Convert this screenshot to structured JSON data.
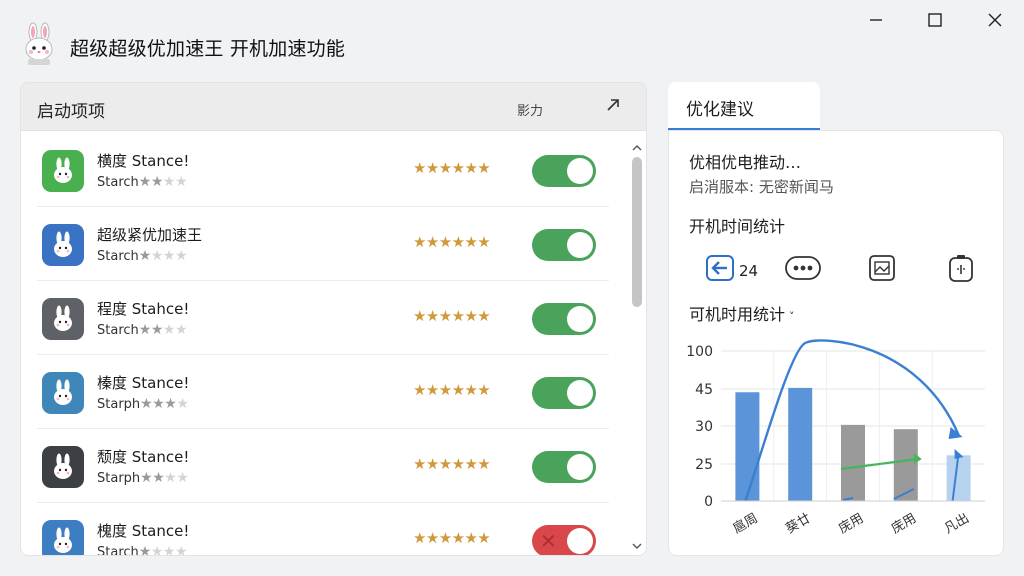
{
  "window": {
    "title": "超级超级优加速王 开机加速功能"
  },
  "startup_panel": {
    "title": "启动项项",
    "impact_label": "影力",
    "items": [
      {
        "name": "横度 Stance!",
        "sub": "Starch",
        "mini_stars": 2,
        "rating": 6,
        "enabled": true,
        "icon_color": "#49b04f"
      },
      {
        "name": "超级紧优加速王",
        "sub": "Starch",
        "mini_stars": 1,
        "rating": 6,
        "enabled": true,
        "icon_color": "#3a72c4"
      },
      {
        "name": "程度 Stahce!",
        "sub": "Starch",
        "mini_stars": 2,
        "rating": 6,
        "enabled": true,
        "icon_color": "#5e6166"
      },
      {
        "name": "榛度 Stance!",
        "sub": "Starph",
        "mini_stars": 3,
        "rating": 6,
        "enabled": true,
        "icon_color": "#3f86b9"
      },
      {
        "name": "颓度 Stance!",
        "sub": "Starph",
        "mini_stars": 2,
        "rating": 6,
        "enabled": true,
        "icon_color": "#3c3f44"
      },
      {
        "name": "槐度 Stance!",
        "sub": "Starch",
        "mini_stars": 1,
        "rating": 6,
        "enabled": false,
        "icon_color": "#3d7ec3"
      }
    ]
  },
  "suggestions": {
    "tab_label": "优化建议",
    "line1": "优相优电推动…",
    "line2": "启消服本: 无密新闻马",
    "boot_time_title": "开机时间统计",
    "count_value": "24",
    "stats_title": "可机时用统计",
    "icons": [
      "back-arrow-icon",
      "more-dots-icon",
      "image-icon",
      "battery-icon"
    ]
  },
  "chart_data": {
    "type": "bar",
    "categories": [
      "扈周",
      "葵廿",
      "庑用",
      "庑用",
      "凡出"
    ],
    "values": [
      50,
      52,
      35,
      33,
      21
    ],
    "bar_colors": [
      "#5b94d8",
      "#5b94d8",
      "#9a9a9a",
      "#9a9a9a",
      "#b7d2ef"
    ],
    "y_ticks": [
      "100",
      "45",
      "30",
      "25",
      "0"
    ],
    "curve_color": "#3a80d2",
    "trend_color": "#48b55a"
  },
  "colors": {
    "toggle_on": "#4aa35a",
    "toggle_off": "#d8474a",
    "accent": "#3a7bd5",
    "star": "#d09a3c"
  }
}
